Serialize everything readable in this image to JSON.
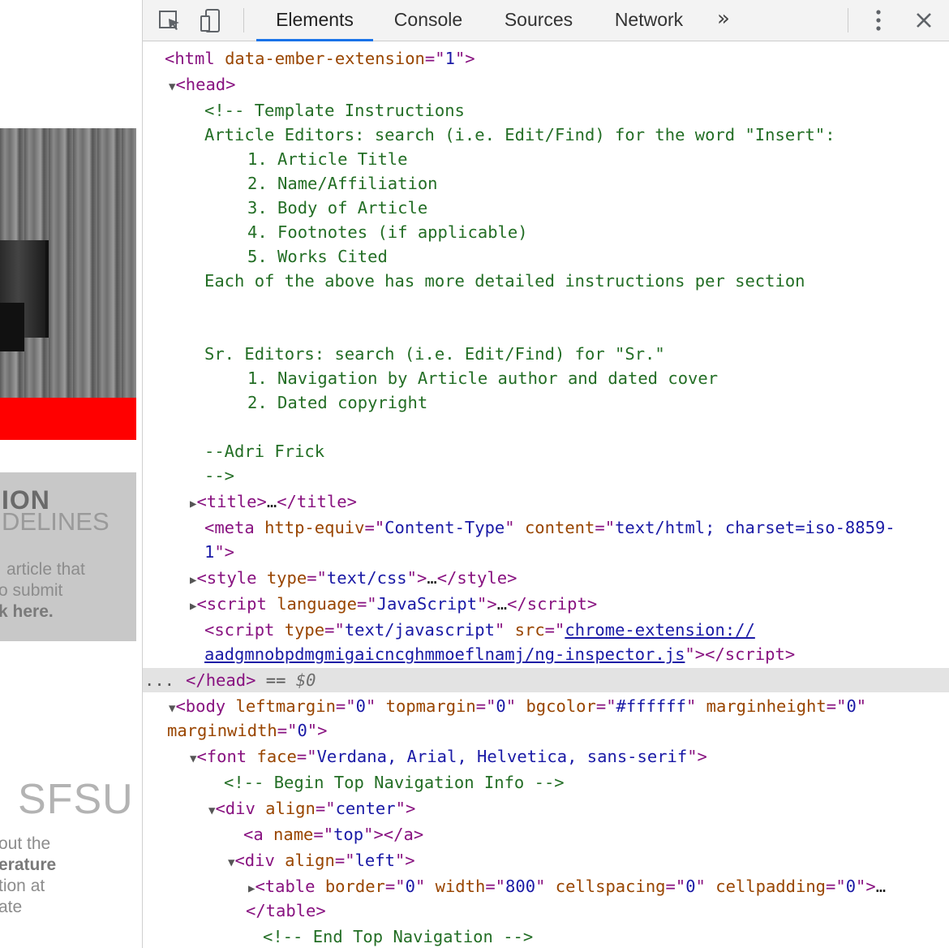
{
  "page_strip": {
    "heading": "ION",
    "subheading": "DELINES",
    "lines": [
      "article that",
      "o submit",
      "k here."
    ],
    "logo": "SFSU",
    "about_lines": [
      "out the",
      "erature",
      "tion at",
      "ate"
    ]
  },
  "toolbar": {
    "tabs": [
      "Elements",
      "Console",
      "Sources",
      "Network"
    ],
    "more": "»",
    "menu": "⋮",
    "close": "×"
  },
  "code": {
    "html_open": {
      "tag": "html",
      "attr": "data-ember-extension",
      "value": "1"
    },
    "head_open": "head",
    "comment": [
      "<!-- Template Instructions",
      "Article Editors: search (i.e. Edit/Find) for the word \"Insert\":",
      "1. Article Title",
      "2. Name/Affiliation",
      "3. Body of Article",
      "4. Footnotes (if applicable)",
      "5. Works Cited",
      "Each of the above has more detailed instructions per section",
      "Sr. Editors: search (i.e. Edit/Find) for \"Sr.\"",
      "1. Navigation by Article author and dated cover",
      "2. Dated copyright",
      "--Adri Frick",
      "-->"
    ],
    "title_line": {
      "tag": "title",
      "ellipsis": "…"
    },
    "meta_line": {
      "tag": "meta",
      "attr1": "http-equiv",
      "val1": "Content-Type",
      "attr2": "content",
      "val2": "text/html; charset=iso-8859-",
      "wrap": "1"
    },
    "style_line": {
      "tag": "style",
      "attr": "type",
      "val": "text/css",
      "ellipsis": "…"
    },
    "script1_line": {
      "tag": "script",
      "attr": "language",
      "val": "JavaScript",
      "ellipsis": "…"
    },
    "script2_line": {
      "tag": "script",
      "attr1": "type",
      "val1": "text/javascript",
      "attr2": "src",
      "link1": "chrome-extension://",
      "link2": "aadgmnobpdmgmigaicncghmmoeflnamj/ng-inspector.js"
    },
    "head_close": {
      "tag": "/head",
      "dots": "...",
      "eq": "== ",
      "dollar": "$0"
    },
    "body_line": {
      "tag": "body",
      "attr1": "leftmargin",
      "val1": "0",
      "attr2": "topmargin",
      "val2": "0",
      "attr3": "bgcolor",
      "val3": "#ffffff",
      "attr4": "marginheight",
      "val4": "0",
      "attr5": "marginwidth",
      "val5": "0"
    },
    "font_line": {
      "tag": "font",
      "attr": "face",
      "val": "Verdana, Arial, Helvetica, sans-serif"
    },
    "nav_comment": "<!-- Begin Top Navigation Info -->",
    "div_center": {
      "tag": "div",
      "attr": "align",
      "val": "center"
    },
    "anchor_line": {
      "tag": "a",
      "attr": "name",
      "val": "top",
      "close": "/a"
    },
    "div_left": {
      "tag": "div",
      "attr": "align",
      "val": "left"
    },
    "table_line": {
      "tag": "table",
      "attr1": "border",
      "val1": "0",
      "attr2": "width",
      "val2": "800",
      "attr3": "cellspacing",
      "val3": "0",
      "attr4": "cellpadding",
      "val4": "0",
      "ellipsis": "…",
      "close": "/table"
    },
    "end_comment": "<!-- End Top Navigation -->"
  },
  "colors": {
    "tag": "#881280",
    "attribute": "#994500",
    "value": "#1a1aa6",
    "comment": "#236e25",
    "active_tab": "#1a73e8",
    "selection": "#e3e3e3"
  },
  "icons": [
    "inspect-element-icon",
    "device-toolbar-icon",
    "more-tabs-icon",
    "kebab-menu-icon",
    "close-icon",
    "expand-triangle-icon",
    "collapse-triangle-icon"
  ]
}
